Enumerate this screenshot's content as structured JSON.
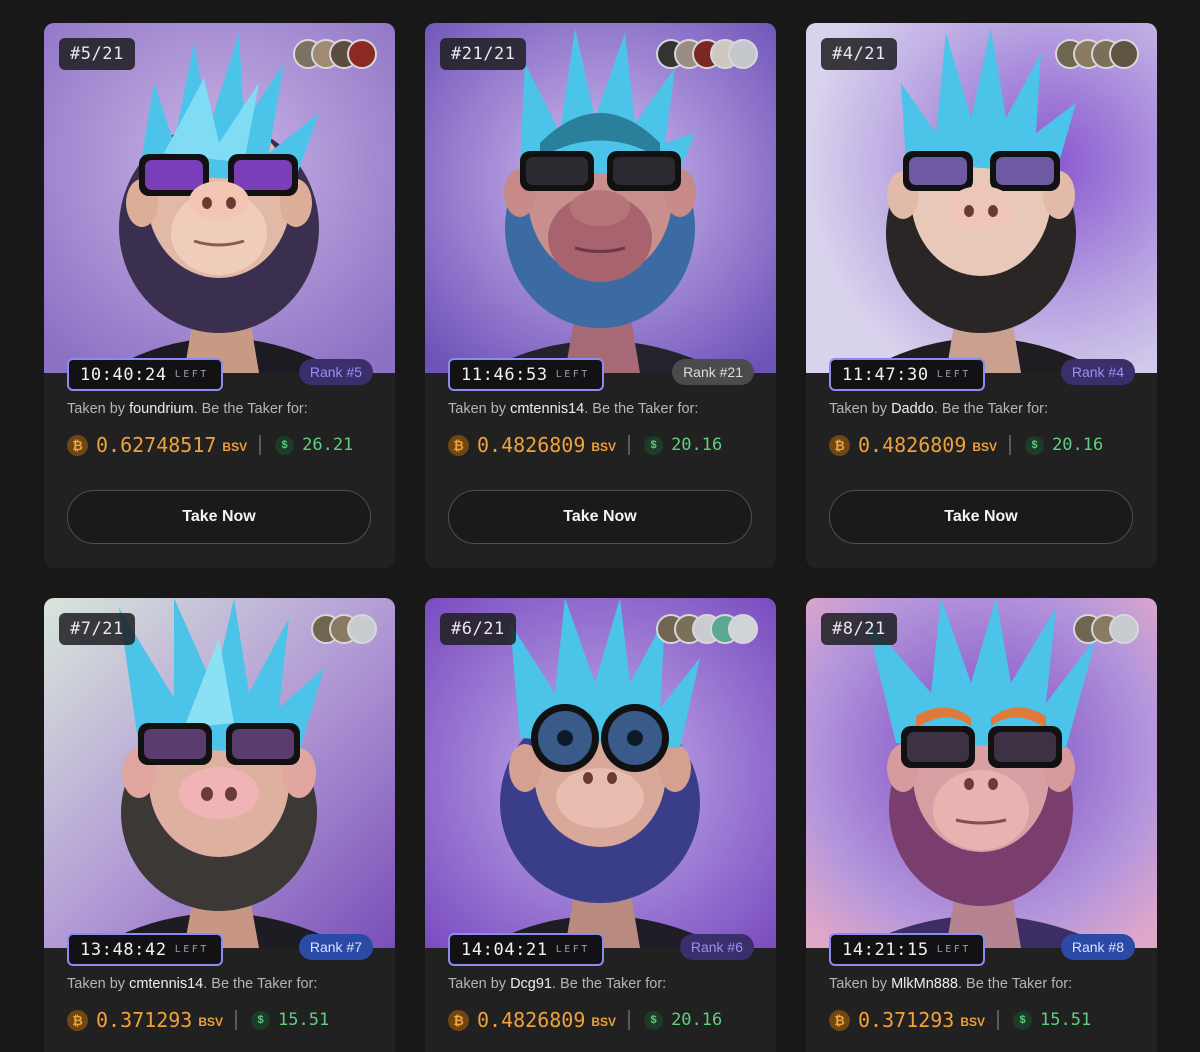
{
  "cards": [
    {
      "edition": "#5/21",
      "timer": "10:40:24",
      "left_label": "LEFT",
      "rank": "Rank #5",
      "taken_prefix": "Taken by ",
      "taker": "foundrium",
      "taken_suffix": ". Be the Taker for:",
      "btc_symbol": "₿",
      "price_bsv": "0.62748517",
      "unit": "BSV",
      "usd_symbol": "$",
      "price_usd": "26.21",
      "button": "Take Now"
    },
    {
      "edition": "#21/21",
      "timer": "11:46:53",
      "left_label": "LEFT",
      "rank": "Rank #21",
      "taken_prefix": "Taken by ",
      "taker": "cmtennis14",
      "taken_suffix": ". Be the Taker for:",
      "btc_symbol": "₿",
      "price_bsv": "0.4826809",
      "unit": "BSV",
      "usd_symbol": "$",
      "price_usd": "20.16",
      "button": "Take Now"
    },
    {
      "edition": "#4/21",
      "timer": "11:47:30",
      "left_label": "LEFT",
      "rank": "Rank #4",
      "taken_prefix": "Taken by ",
      "taker": "Daddo",
      "taken_suffix": ". Be the Taker for:",
      "btc_symbol": "₿",
      "price_bsv": "0.4826809",
      "unit": "BSV",
      "usd_symbol": "$",
      "price_usd": "20.16",
      "button": "Take Now"
    },
    {
      "edition": "#7/21",
      "timer": "13:48:42",
      "left_label": "LEFT",
      "rank": "Rank #7",
      "taken_prefix": "Taken by ",
      "taker": "cmtennis14",
      "taken_suffix": ". Be the Taker for:",
      "btc_symbol": "₿",
      "price_bsv": "0.371293",
      "unit": "BSV",
      "usd_symbol": "$",
      "price_usd": "15.51"
    },
    {
      "edition": "#6/21",
      "timer": "14:04:21",
      "left_label": "LEFT",
      "rank": "Rank #6",
      "taken_prefix": "Taken by ",
      "taker": "Dcg91",
      "taken_suffix": ". Be the Taker for:",
      "btc_symbol": "₿",
      "price_bsv": "0.4826809",
      "unit": "BSV",
      "usd_symbol": "$",
      "price_usd": "20.16"
    },
    {
      "edition": "#8/21",
      "timer": "14:21:15",
      "left_label": "LEFT",
      "rank": "Rank #8",
      "taken_prefix": "Taken by ",
      "taker": "MlkMn888",
      "taken_suffix": ". Be the Taker for:",
      "btc_symbol": "₿",
      "price_bsv": "0.371293",
      "unit": "BSV",
      "usd_symbol": "$",
      "price_usd": "15.51"
    }
  ],
  "colors": {
    "page_bg": "#181818",
    "card_bg": "#212121",
    "bsv": "#f0a13a",
    "usd": "#5fcf80",
    "timer_border": "#8c8cf0"
  },
  "art": {
    "subject": "ape-avatar",
    "hair": "#4cc4ea"
  }
}
